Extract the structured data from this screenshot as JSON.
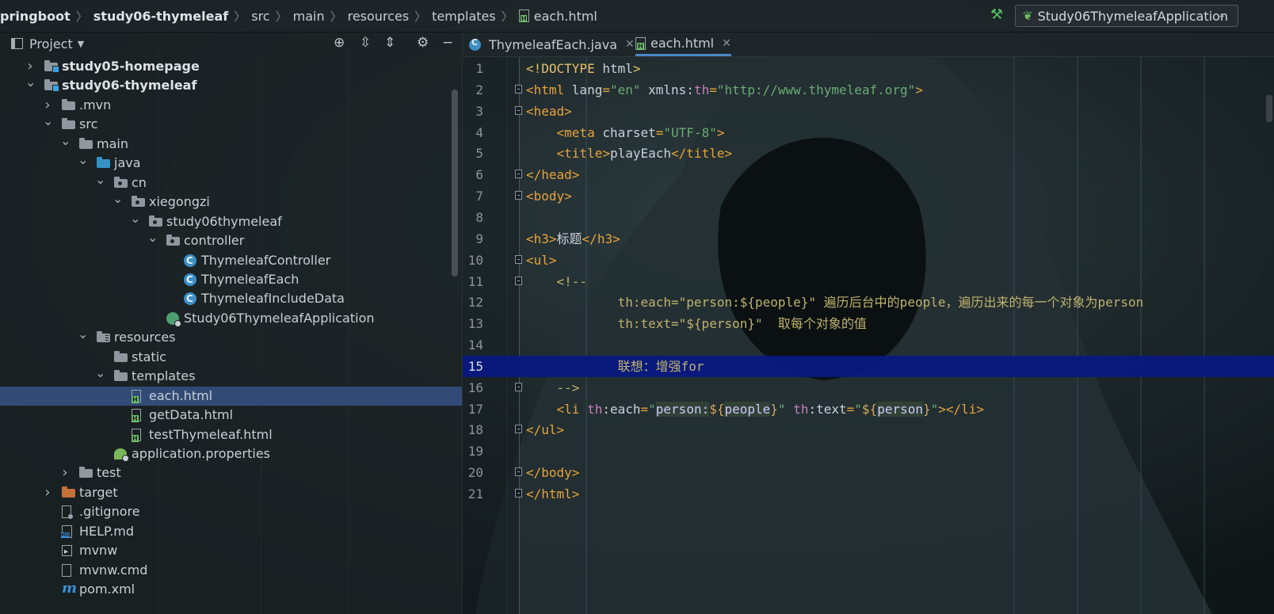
{
  "breadcrumbs": [
    "pringboot",
    "study06-thymeleaf",
    "src",
    "main",
    "resources",
    "templates",
    "each.html"
  ],
  "run_config": {
    "label": "Study06ThymeleafApplication"
  },
  "project_panel": {
    "title": "Project"
  },
  "tree": [
    {
      "label": "study05-homepage",
      "icon": "module-folder",
      "depth": 1,
      "arrow": "right",
      "bold": true
    },
    {
      "label": "study06-thymeleaf",
      "icon": "module-folder",
      "depth": 1,
      "arrow": "down",
      "bold": true
    },
    {
      "label": ".mvn",
      "icon": "folder",
      "depth": 2,
      "arrow": "right"
    },
    {
      "label": "src",
      "icon": "folder",
      "depth": 2,
      "arrow": "down"
    },
    {
      "label": "main",
      "icon": "folder",
      "depth": 3,
      "arrow": "down"
    },
    {
      "label": "java",
      "icon": "source-folder",
      "depth": 4,
      "arrow": "down"
    },
    {
      "label": "cn",
      "icon": "package",
      "depth": 5,
      "arrow": "down"
    },
    {
      "label": "xiegongzi",
      "icon": "package",
      "depth": 6,
      "arrow": "down"
    },
    {
      "label": "study06thymeleaf",
      "icon": "package",
      "depth": 7,
      "arrow": "down"
    },
    {
      "label": "controller",
      "icon": "package",
      "depth": 8,
      "arrow": "down"
    },
    {
      "label": "ThymeleafController",
      "icon": "class",
      "depth": 9
    },
    {
      "label": "ThymeleafEach",
      "icon": "class",
      "depth": 9
    },
    {
      "label": "ThymeleafIncludeData",
      "icon": "class",
      "depth": 9
    },
    {
      "label": "Study06ThymeleafApplication",
      "icon": "spring-app",
      "depth": 8
    },
    {
      "label": "resources",
      "icon": "resources-folder",
      "depth": 4,
      "arrow": "down"
    },
    {
      "label": "static",
      "icon": "folder",
      "depth": 5
    },
    {
      "label": "templates",
      "icon": "folder",
      "depth": 5,
      "arrow": "down"
    },
    {
      "label": "each.html",
      "icon": "html-file",
      "depth": 6,
      "selected": true
    },
    {
      "label": "getData.html",
      "icon": "html-file",
      "depth": 6
    },
    {
      "label": "testThymeleaf.html",
      "icon": "html-file",
      "depth": 6
    },
    {
      "label": "application.properties",
      "icon": "properties-file",
      "depth": 5
    },
    {
      "label": "test",
      "icon": "folder",
      "depth": 3,
      "arrow": "right"
    },
    {
      "label": "target",
      "icon": "excluded-folder",
      "depth": 2,
      "arrow": "right"
    },
    {
      "label": ".gitignore",
      "icon": "gitignore-file",
      "depth": 2
    },
    {
      "label": "HELP.md",
      "icon": "markdown-file",
      "depth": 2
    },
    {
      "label": "mvnw",
      "icon": "script-file",
      "depth": 2
    },
    {
      "label": "mvnw.cmd",
      "icon": "text-file",
      "depth": 2
    },
    {
      "label": "pom.xml",
      "icon": "maven-file",
      "depth": 2
    }
  ],
  "tabs": [
    {
      "label": "ThymeleafEach.java",
      "icon": "class-icon",
      "active": false
    },
    {
      "label": "each.html",
      "icon": "html-icon",
      "active": true
    }
  ],
  "editor": {
    "current_line": 15,
    "lines": [
      {
        "n": "1",
        "fold": false,
        "tokens": [
          [
            "tg",
            "<!DOCTYPE "
          ],
          [
            "at",
            "html"
          ],
          [
            "tg",
            ">"
          ]
        ]
      },
      {
        "n": "2",
        "fold": true,
        "tokens": [
          [
            "tk",
            "<html "
          ],
          [
            "at",
            "lang"
          ],
          [
            "tk",
            "="
          ],
          [
            "st",
            "\"en\""
          ],
          [
            "at",
            " xmlns:"
          ],
          [
            "ns",
            "th"
          ],
          [
            "tk",
            "="
          ],
          [
            "st",
            "\"http://www.thymeleaf.org\""
          ],
          [
            "tk",
            ">"
          ]
        ]
      },
      {
        "n": "3",
        "fold": true,
        "tokens": [
          [
            "tk",
            "<head>"
          ]
        ]
      },
      {
        "n": "4",
        "fold": false,
        "tokens": [
          [
            "at",
            "    "
          ],
          [
            "tk",
            "<meta "
          ],
          [
            "at",
            "charset"
          ],
          [
            "tk",
            "="
          ],
          [
            "st",
            "\"UTF-8\""
          ],
          [
            "tk",
            ">"
          ]
        ]
      },
      {
        "n": "5",
        "fold": false,
        "tokens": [
          [
            "at",
            "    "
          ],
          [
            "tk",
            "<title>"
          ],
          [
            "at",
            "playEach"
          ],
          [
            "tk",
            "</title>"
          ]
        ]
      },
      {
        "n": "6",
        "fold": true,
        "tokens": [
          [
            "tk",
            "</head>"
          ]
        ]
      },
      {
        "n": "7",
        "fold": true,
        "tokens": [
          [
            "tk",
            "<body>"
          ]
        ]
      },
      {
        "n": "8",
        "fold": false,
        "tokens": []
      },
      {
        "n": "9",
        "fold": false,
        "tokens": [
          [
            "tk",
            "<h3>"
          ],
          [
            "at",
            "标题"
          ],
          [
            "tk",
            "</h3>"
          ]
        ]
      },
      {
        "n": "10",
        "fold": true,
        "tokens": [
          [
            "tk",
            "<ul>"
          ]
        ]
      },
      {
        "n": "11",
        "fold": true,
        "tokens": [
          [
            "cm",
            "    <!--"
          ]
        ]
      },
      {
        "n": "12",
        "fold": false,
        "tokens": [
          [
            "cm",
            "            th:each=\"person:${people}\" 遍历后台中的people，遍历出来的每一个对象为person"
          ]
        ]
      },
      {
        "n": "13",
        "fold": false,
        "tokens": [
          [
            "cm",
            "            th:text=\"${person}\"  取每个对象的值"
          ]
        ]
      },
      {
        "n": "14",
        "fold": false,
        "tokens": []
      },
      {
        "n": "15",
        "fold": false,
        "tokens": [
          [
            "cm",
            "            联想：增强for"
          ]
        ]
      },
      {
        "n": "16",
        "fold": true,
        "tokens": [
          [
            "cm",
            "    -->"
          ]
        ]
      },
      {
        "n": "17",
        "fold": false,
        "tokens": [
          [
            "at",
            "    "
          ],
          [
            "tk",
            "<li "
          ],
          [
            "ns",
            "th"
          ],
          [
            "at",
            ":each"
          ],
          [
            "tk",
            "="
          ],
          [
            "st",
            "\""
          ],
          [
            "ex",
            "person:"
          ],
          [
            "exd",
            "${"
          ],
          [
            "ex",
            "people"
          ],
          [
            "exd",
            "}"
          ],
          [
            "st",
            "\""
          ],
          [
            "at",
            " "
          ],
          [
            "ns",
            "th"
          ],
          [
            "at",
            ":text"
          ],
          [
            "tk",
            "="
          ],
          [
            "st",
            "\""
          ],
          [
            "exd",
            "${"
          ],
          [
            "ex",
            "person"
          ],
          [
            "exd",
            "}"
          ],
          [
            "st",
            "\""
          ],
          [
            "tk",
            "></li>"
          ]
        ]
      },
      {
        "n": "18",
        "fold": true,
        "tokens": [
          [
            "tk",
            "</ul>"
          ]
        ]
      },
      {
        "n": "19",
        "fold": false,
        "tokens": []
      },
      {
        "n": "20",
        "fold": true,
        "tokens": [
          [
            "tk",
            "</body>"
          ]
        ]
      },
      {
        "n": "21",
        "fold": true,
        "tokens": [
          [
            "tk",
            "</html>"
          ]
        ]
      }
    ]
  },
  "colors": {
    "selection": "#355080",
    "caret_line": "#071982",
    "tag": "#e6a43a",
    "string": "#6aab73",
    "comment": "#c0b26d",
    "namespace": "#c77dbb"
  }
}
